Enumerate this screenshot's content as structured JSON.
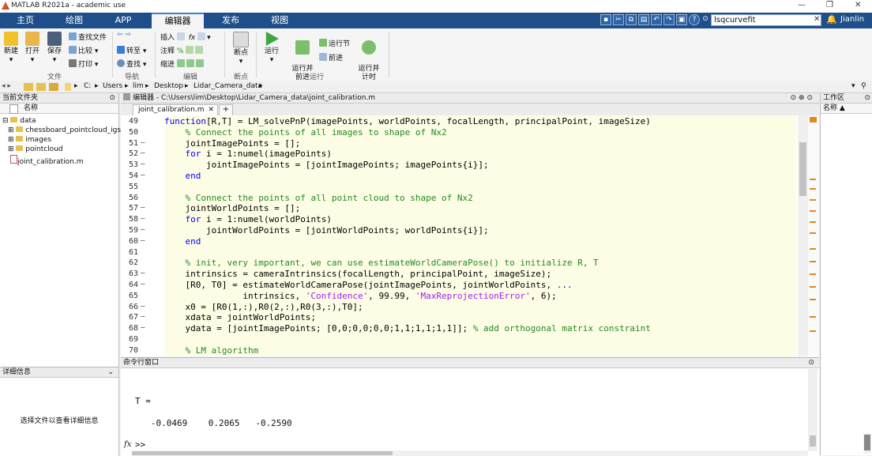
{
  "window": {
    "title": "MATLAB R2021a - academic use",
    "controls": [
      "—",
      "❐",
      "✕"
    ]
  },
  "tabs": [
    "主页",
    "绘图",
    "APP",
    "编辑器",
    "发布",
    "视图"
  ],
  "search": {
    "value": "lsqcurvefit"
  },
  "user": "Jianlin",
  "ribbon": {
    "file": {
      "new": "新建",
      "open": "打开",
      "save": "保存",
      "find_files": "查找文件",
      "compare": "比较",
      "print": "打印",
      "group": "文件"
    },
    "nav": {
      "goto": "转至",
      "find": "查找",
      "group": "导航"
    },
    "edit": {
      "insert": "插入",
      "comment": "注释",
      "indent": "缩进",
      "fx": "fx",
      "group": "编辑"
    },
    "breakpoints": {
      "label": "断点",
      "group": "断点"
    },
    "run": {
      "run": "运行",
      "run_advance": "运行并\n前进",
      "run_section": "运行节",
      "advance": "前进",
      "run_time": "运行并\n计时",
      "group": "运行"
    }
  },
  "address": [
    "C:",
    "Users",
    "lim",
    "Desktop",
    "Lidar_Camera_data"
  ],
  "current_folder": {
    "title": "当前文件夹",
    "col": "名称",
    "items": [
      {
        "name": "data",
        "indent": 0
      },
      {
        "name": "chessboard_pointcloud_igs",
        "indent": 1
      },
      {
        "name": "images",
        "indent": 1
      },
      {
        "name": "pointcloud",
        "indent": 1
      },
      {
        "name": "joint_calibration.m",
        "indent": 0
      }
    ]
  },
  "details": {
    "title": "详细信息",
    "message": "选择文件以查看详细信息"
  },
  "editor": {
    "title": "编辑器 - C:\\Users\\lim\\Desktop\\Lidar_Camera_data\\joint_calibration.m",
    "tab": "joint_calibration.m",
    "lines": [
      {
        "n": "49",
        "d": "",
        "code": [
          [
            "kw",
            "function"
          ],
          [
            "",
            "[R,T] = LM_solvePnP(imagePoints, worldPoints, focalLength, principalPoint, imageSize)"
          ]
        ]
      },
      {
        "n": "50",
        "d": "",
        "code": [
          [
            "",
            "    "
          ],
          [
            "cm",
            "% Connect the points of all images to shape of Nx2"
          ]
        ]
      },
      {
        "n": "51",
        "d": "–",
        "code": [
          [
            "",
            "    jointImagePoints = [];"
          ]
        ]
      },
      {
        "n": "52",
        "d": "–",
        "code": [
          [
            "",
            "    "
          ],
          [
            "kw",
            "for"
          ],
          [
            "",
            " i = 1:numel(imagePoints)"
          ]
        ]
      },
      {
        "n": "53",
        "d": "–",
        "code": [
          [
            "",
            "        jointImagePoints = [jointImagePoints; imagePoints{i}];"
          ]
        ]
      },
      {
        "n": "54",
        "d": "–",
        "code": [
          [
            "",
            "    "
          ],
          [
            "kw",
            "end"
          ]
        ]
      },
      {
        "n": "55",
        "d": "",
        "code": [
          [
            "",
            ""
          ]
        ]
      },
      {
        "n": "56",
        "d": "",
        "code": [
          [
            "",
            "    "
          ],
          [
            "cm",
            "% Connect the points of all point cloud to shape of Nx2"
          ]
        ]
      },
      {
        "n": "57",
        "d": "–",
        "code": [
          [
            "",
            "    jointWorldPoints = [];"
          ]
        ]
      },
      {
        "n": "58",
        "d": "–",
        "code": [
          [
            "",
            "    "
          ],
          [
            "kw",
            "for"
          ],
          [
            "",
            " i = 1:numel(worldPoints)"
          ]
        ]
      },
      {
        "n": "59",
        "d": "–",
        "code": [
          [
            "",
            "        jointWorldPoints = [jointWorldPoints; worldPoints{i}];"
          ]
        ]
      },
      {
        "n": "60",
        "d": "–",
        "code": [
          [
            "",
            "    "
          ],
          [
            "kw",
            "end"
          ]
        ]
      },
      {
        "n": "61",
        "d": "",
        "code": [
          [
            "",
            ""
          ]
        ]
      },
      {
        "n": "62",
        "d": "",
        "code": [
          [
            "",
            "    "
          ],
          [
            "cm",
            "% init, very important, we can use estimateWorldCameraPose() to initialize R, T"
          ]
        ]
      },
      {
        "n": "63",
        "d": "–",
        "code": [
          [
            "",
            "    intrinsics = cameraIntrinsics(focalLength, principalPoint, imageSize);"
          ]
        ]
      },
      {
        "n": "64",
        "d": "–",
        "code": [
          [
            "",
            "    [R0, T0] = estimateWorldCameraPose(jointImagePoints, jointWorldPoints, "
          ],
          [
            "kw",
            "..."
          ]
        ]
      },
      {
        "n": "65",
        "d": "",
        "code": [
          [
            "",
            "               intrinsics, "
          ],
          [
            "st",
            "'Confidence'"
          ],
          [
            "",
            ", 99.99, "
          ],
          [
            "st",
            "'MaxReprojectionError'"
          ],
          [
            "",
            ", 6);"
          ]
        ]
      },
      {
        "n": "66",
        "d": "–",
        "code": [
          [
            "",
            "    x0 = [R0(1,:),R0(2,:),R0(3,:),T0];"
          ]
        ]
      },
      {
        "n": "67",
        "d": "–",
        "code": [
          [
            "",
            "    xdata = jointWorldPoints;"
          ]
        ]
      },
      {
        "n": "68",
        "d": "–",
        "code": [
          [
            "",
            "    ydata = [jointImagePoints; [0,0;0,0;0,0;1,1;1,1;1,1]]; "
          ],
          [
            "cm",
            "% add orthogonal matrix constraint"
          ]
        ]
      },
      {
        "n": "69",
        "d": "",
        "code": [
          [
            "",
            ""
          ]
        ]
      },
      {
        "n": "70",
        "d": "",
        "code": [
          [
            "",
            "    "
          ],
          [
            "cm",
            "% LM algorithm"
          ]
        ]
      }
    ]
  },
  "command": {
    "title": "命令行窗口",
    "var": "T =",
    "values": "   -0.0469    0.2065   -0.2590",
    "prompt": ">>"
  },
  "workspace": {
    "title": "工作区",
    "col": "名称 ▲"
  }
}
